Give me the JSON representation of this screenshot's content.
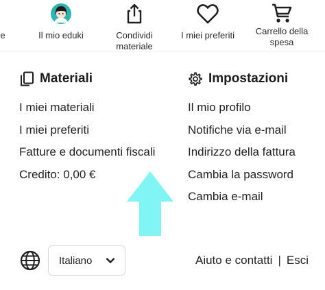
{
  "topnav": {
    "items": [
      {
        "label": "ve",
        "icon": "truncated-item"
      },
      {
        "label": "Il mio eduki",
        "icon": "avatar-icon"
      },
      {
        "label": "Condividi materiale",
        "icon": "share-upload-icon"
      },
      {
        "label": "I miei preferiti",
        "icon": "heart-icon"
      },
      {
        "label": "Carrello della spesa",
        "icon": "shopping-cart-icon"
      }
    ]
  },
  "materials": {
    "title": "Materiali",
    "icon": "copy-documents-icon",
    "links": [
      "I miei materiali",
      "I miei preferiti",
      "Fatture e documenti fiscali",
      "Credito: 0,00 €"
    ]
  },
  "settings": {
    "title": "Impostazioni",
    "icon": "gear-icon",
    "links": [
      "Il mio profilo",
      "Notifiche via e-mail",
      "Indirizzo della fattura",
      "Cambia la password",
      "Cambia e-mail"
    ]
  },
  "annotation": {
    "icon": "up-arrow-icon",
    "color": "#7ff5f5"
  },
  "footer": {
    "language": {
      "selected": "Italiano",
      "icon": "globe-icon"
    },
    "help_label": "Aiuto e contatti",
    "separator": "|",
    "logout_label": "Esci"
  },
  "colors": {
    "avatar_bg": "#2ab5b0",
    "text": "#1f1f1f",
    "arrow": "#7ff5f5"
  }
}
